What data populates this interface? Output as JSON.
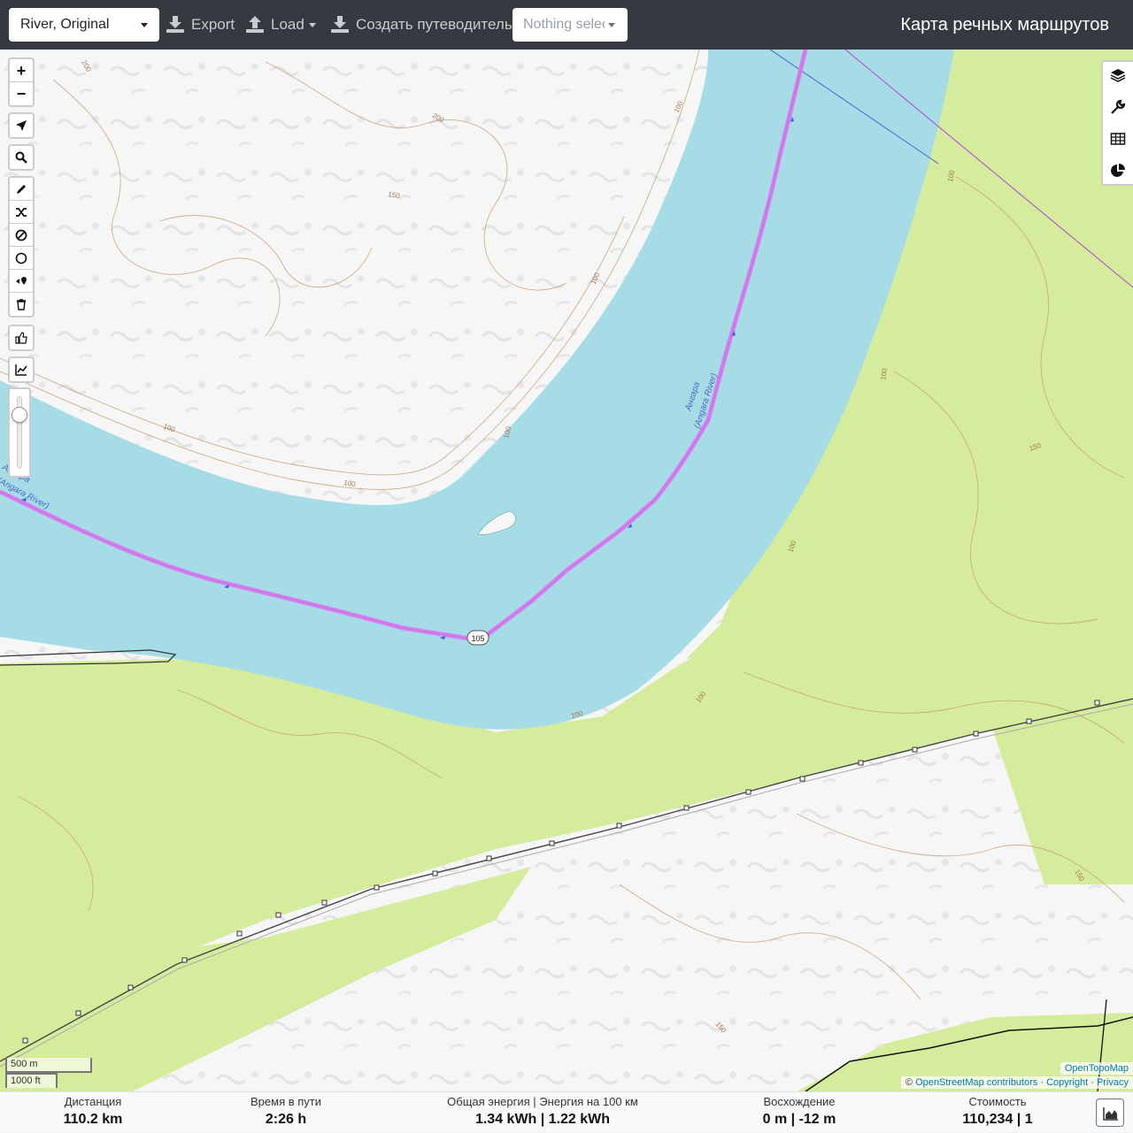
{
  "toolbar": {
    "profile_value": "River, Original",
    "export_label": "Export",
    "load_label": "Load",
    "guide_label": "Создать путеводитель",
    "selection_value": "Nothing selected",
    "app_title": "Карта речных маршрутов"
  },
  "map": {
    "route_color": "#d77ef0",
    "water_color": "#a5dce6",
    "forest_color": "#d4ec9c",
    "route_marker_label": "105",
    "river_labels": [
      {
        "name": "Ангара",
        "name_en": "(Angara River)"
      },
      {
        "name": "Ангара",
        "name_en": "(Angara River)"
      }
    ],
    "contour_labels": [
      "200",
      "200",
      "150",
      "100",
      "100",
      "100",
      "100",
      "100",
      "100",
      "100",
      "150",
      "100",
      "100",
      "100",
      "150",
      "150"
    ],
    "zoom_in": "+",
    "zoom_out": "−",
    "scale_metric": "500 m",
    "scale_imperial": "1000 ft",
    "attribution_tiles": "OpenTopoMap",
    "attribution_osm_prefix": "©",
    "attribution_osm": "OpenStreetMap contributors",
    "attribution_sep": "·",
    "attribution_copyright": "Copyright",
    "attribution_privacy": "Privacy",
    "opacity": 0.82,
    "left_controls": [
      "zoom-in-icon",
      "zoom-out-icon",
      "locate-icon",
      "search-icon",
      "draw-icon",
      "reroute-icon",
      "no-go-icon",
      "circle-icon",
      "waypoint-icon",
      "trash-icon",
      "thumb-icon",
      "chart-icon"
    ],
    "right_controls": [
      "layers-icon",
      "wrench-icon",
      "table-icon",
      "pie-chart-icon"
    ]
  },
  "stats": {
    "distance": {
      "label": "Дистанция",
      "value": "110.2 km"
    },
    "time": {
      "label": "Время в пути",
      "value": "2:26 h"
    },
    "energy": {
      "label": "Общая энергия | Энергия на 100 км",
      "value": "1.34 kWh | 1.22 kWh"
    },
    "ascent": {
      "label": "Восхождение",
      "value": "0 m | -12 m"
    },
    "cost": {
      "label": "Стоимость",
      "value": "110,234 | 1"
    }
  }
}
